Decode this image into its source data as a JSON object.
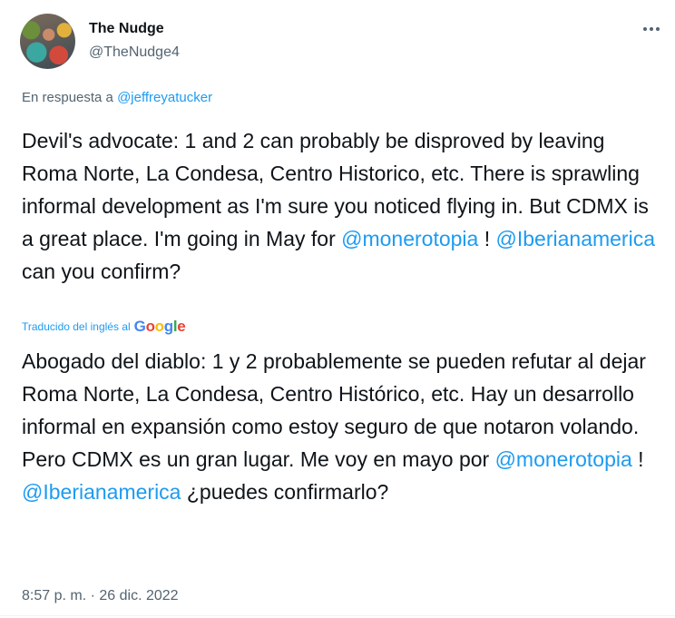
{
  "user": {
    "display_name": "The Nudge",
    "handle": "@TheNudge4"
  },
  "reply": {
    "prefix": "En respuesta a",
    "to": "@jeffreyatucker"
  },
  "original": {
    "text": "Devil's advocate: 1 and 2 can probably be disproved by leaving Roma Norte, La Condesa, Centro Historico, etc. There is sprawling informal development as I'm sure you noticed flying in. But CDMX is a great place. I'm going in May for",
    "mention1": "@monerotopia",
    "sep": " ! ",
    "mention2": "@Iberianamerica",
    "suffix": "can you confirm?"
  },
  "translation": {
    "label": "Traducido del inglés al",
    "provider": "Google",
    "provider_letters": [
      "G",
      "o",
      "o",
      "g",
      "l",
      "e"
    ],
    "provider_colors": [
      "#4285f4",
      "#ea4335",
      "#fbbc05",
      "#4285f4",
      "#34a853",
      "#ea4335"
    ],
    "text": "Abogado del diablo: 1 y 2 probablemente se pueden refutar al dejar Roma Norte, La Condesa, Centro Histórico, etc. Hay un desarrollo informal en expansión como estoy seguro de que notaron volando. Pero CDMX es un gran lugar. Me voy en mayo por",
    "mention1": "@monerotopia",
    "sep": " ! ",
    "mention2": "@Iberianamerica",
    "suffix": "¿puedes confirmarlo?"
  },
  "timestamp": "8:57 p. m. · 26 dic. 2022",
  "colors": {
    "accent": "#1d9bf0",
    "secondary_text": "#536471",
    "primary_text": "#0f1419"
  },
  "icons": {
    "more": "more-horizontal-icon"
  }
}
